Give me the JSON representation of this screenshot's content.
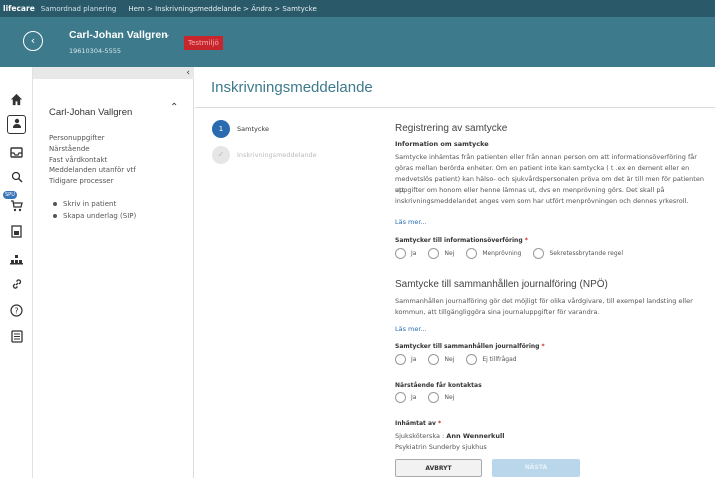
{
  "topbar": {
    "brand": "lifecare",
    "app": "Samordnad planering",
    "breadcrumb": "Hem > Inskrivningsmeddelande > Ändra > Samtycke"
  },
  "patient": {
    "name": "Carl-Johan Vallgren",
    "id": "19610304-5555",
    "environment_badge": "Testmiljö"
  },
  "iconbar": {
    "spu_badge": "SPU",
    "icons": [
      "home-icon",
      "person-icon",
      "inbox-icon",
      "search-icon",
      "cart-icon",
      "document-icon",
      "organization-icon",
      "link-icon",
      "help-icon",
      "form-icon"
    ]
  },
  "left_panel": {
    "patient_name": "Carl-Johan Vallgren",
    "items": [
      "Personuppgifter",
      "Närstående",
      "Fast vårdkontakt",
      "Meddelanden utanför vtf",
      "Tidigare processer"
    ],
    "sub_items": [
      "Skriv in patient",
      "Skapa underlag (SIP)"
    ]
  },
  "main": {
    "title": "Inskrivningsmeddelande",
    "steps": [
      {
        "number": "1",
        "label": "Samtycke",
        "state": "active"
      },
      {
        "number": "✓",
        "label": "Inskrivningsmeddelande",
        "state": "inactive"
      }
    ],
    "consent": {
      "heading": "Registrering av samtycke",
      "subheading": "Information om samtycke",
      "para_lines": [
        "Samtycke inhämtas från patienten eller från annan person om att informationsöverföring får",
        "göras mellan berörda enheter. Om en patient inte kan samtycka ( t .ex en dement eller en",
        "medvetslös patient) kan hälso- och sjukvårdspersonalen pröva om det är till men för patienten att",
        "uppgifter om honom eller henne lämnas ut, dvs en menprövning görs. Det skall på",
        "inskrivningsmeddelandet anges vem som har utfört menprövningen och dennes yrkesroll."
      ],
      "read_more": "Läs mer...",
      "question": "Samtycker till informationsöverföring",
      "required_mark": "*",
      "options": [
        "Ja",
        "Nej",
        "Menprövning",
        "Sekretessbrytande regel"
      ]
    },
    "npo": {
      "heading": "Samtycke till sammanhållen journalföring (NPÖ)",
      "para_lines": [
        "Sammanhållen journalföring gör det möjligt för olika vårdgivare, till exempel landsting eller",
        "kommun, att tillgängliggöra sina journaluppgifter för varandra."
      ],
      "read_more": "Läs mer...",
      "question": "Samtycker till sammanhållen journalföring",
      "required_mark": "*",
      "options": [
        "Ja",
        "Nej",
        "Ej tillfrågad"
      ]
    },
    "contact": {
      "question": "Närstående får kontaktas",
      "options": [
        "Ja",
        "Nej"
      ]
    },
    "collected": {
      "label": "Inhämtat av",
      "required_mark": "*",
      "role": "Sjuksköterska :",
      "person": "Ann Wennerkull",
      "unit": "Psykiatrin Sunderby sjukhus"
    },
    "buttons": {
      "cancel": "AVBRYT",
      "next": "NÄSTA"
    }
  }
}
